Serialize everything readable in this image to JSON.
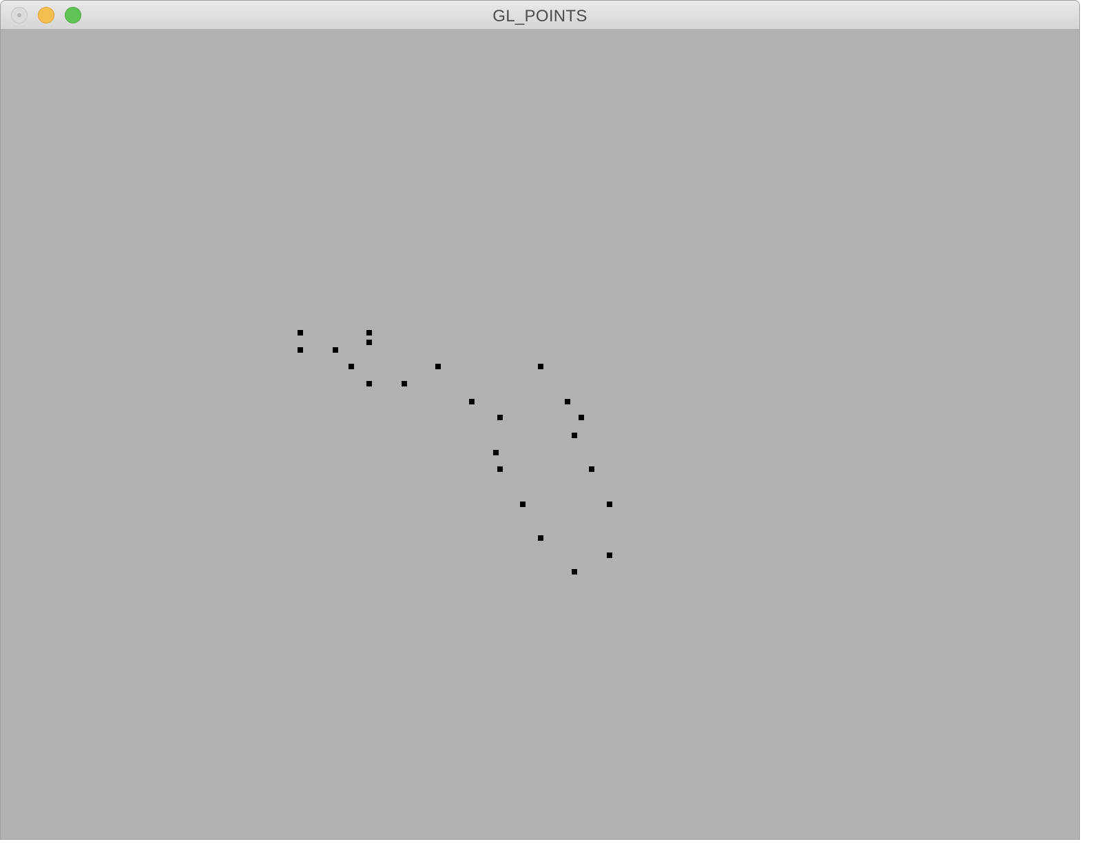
{
  "window": {
    "title": "GL_POINTS",
    "background_color": "#b1b1b1",
    "controls": [
      "close-icon",
      "minimize-icon",
      "zoom-icon"
    ]
  },
  "points_layer": {
    "point_color": "#000000",
    "point_count": 25
  }
}
